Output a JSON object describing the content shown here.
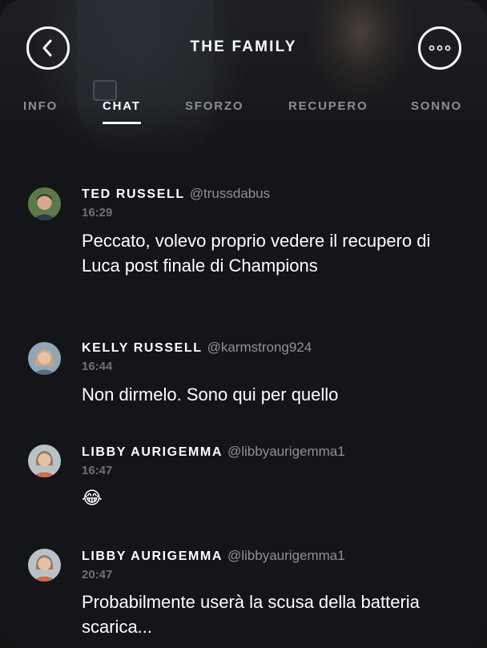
{
  "header": {
    "title": "THE FAMILY",
    "back_icon": "chevron-left-icon",
    "more_icon": "more-dots-icon"
  },
  "tabs": [
    {
      "label": "INFO",
      "active": false
    },
    {
      "label": "CHAT",
      "active": true
    },
    {
      "label": "SFORZO",
      "active": false
    },
    {
      "label": "RECUPERO",
      "active": false
    },
    {
      "label": "SONNO",
      "active": false
    }
  ],
  "messages": [
    {
      "name": "TED RUSSELL",
      "handle": "@trussdabus",
      "time": "16:29",
      "text": "Peccato, volevo proprio vedere il recupero di Luca post finale di Champions",
      "avatar_colors": {
        "bg": "#5b7a4a",
        "face": "#d9a88a",
        "hair": "#3a3a3a"
      }
    },
    {
      "name": "KELLY RUSSELL",
      "handle": "@karmstrong924",
      "time": "16:44",
      "text": "Non dirmelo. Sono qui per quello",
      "avatar_colors": {
        "bg": "#8fa7b8",
        "face": "#e6c2a8",
        "hair": "#c9a777"
      }
    },
    {
      "name": "LIBBY AURIGEMMA",
      "handle": "@libbyaurigemma1",
      "time": "16:47",
      "text": "😂",
      "avatar_colors": {
        "bg": "#b9c2c9",
        "face": "#e8c0a4",
        "hair": "#9a7a58"
      }
    },
    {
      "name": "LIBBY AURIGEMMA",
      "handle": "@libbyaurigemma1",
      "time": "20:47",
      "text": "Probabilmente userà la scusa della batteria scarica...",
      "avatar_colors": {
        "bg": "#b9c2c9",
        "face": "#e8c0a4",
        "hair": "#9a7a58"
      }
    }
  ],
  "colors": {
    "background": "#141518",
    "text_primary": "#ffffff",
    "text_secondary": "#8e9197",
    "text_tertiary": "#6d7076"
  }
}
